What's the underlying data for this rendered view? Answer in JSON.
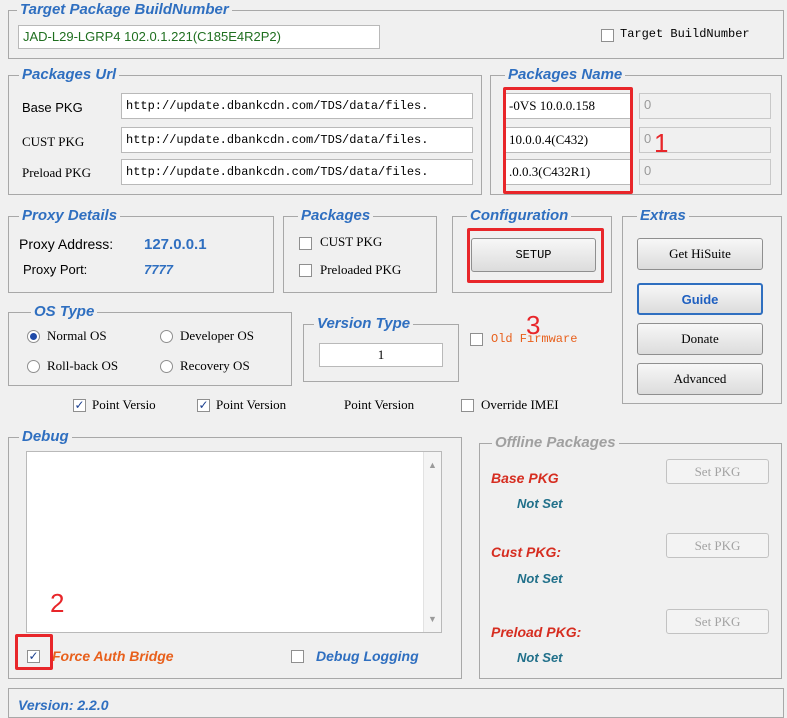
{
  "target_group": {
    "legend": "Target Package BuildNumber",
    "build_number_value": "JAD-L29-LGRP4 102.0.1.221(C185E4R2P2)",
    "checkbox_label": "Target BuildNumber"
  },
  "packages_url": {
    "legend": "Packages Url",
    "rows": [
      {
        "label": "Base PKG",
        "url": "http://update.dbankcdn.com/TDS/data/files."
      },
      {
        "label": "CUST PKG",
        "url": "http://update.dbankcdn.com/TDS/data/files."
      },
      {
        "label": "Preload PKG",
        "url": "http://update.dbankcdn.com/TDS/data/files."
      }
    ]
  },
  "packages_name": {
    "legend": "Packages Name",
    "names": [
      "-0VS 10.0.0.158",
      "10.0.0.4(C432)",
      ".0.0.3(C432R1)"
    ],
    "values": [
      "0",
      "0",
      "0"
    ]
  },
  "proxy": {
    "legend": "Proxy Details",
    "address_label": "Proxy Address:",
    "address_value": "127.0.0.1",
    "port_label": "Proxy Port:",
    "port_value": "7777"
  },
  "packages": {
    "legend": "Packages",
    "cust_pkg": "CUST PKG",
    "preloaded_pkg": "Preloaded PKG"
  },
  "configuration": {
    "legend": "Configuration",
    "setup_button": "SETUP"
  },
  "extras": {
    "legend": "Extras",
    "buttons": [
      "Get HiSuite",
      "Guide",
      "Donate",
      "Advanced"
    ]
  },
  "os_type": {
    "legend": "OS Type",
    "normal": "Normal OS",
    "developer": "Developer OS",
    "rollback": "Roll-back OS",
    "recovery": "Recovery OS"
  },
  "version_type": {
    "legend": "Version Type",
    "value": "1"
  },
  "old_firmware_label": "Old Firmware",
  "point_version_row": {
    "pv1": "Point Versio",
    "pv2": "Point Version",
    "pv3": "Point Version",
    "override_imei": "Override IMEI"
  },
  "debug": {
    "legend": "Debug",
    "force_auth_bridge": "Force Auth Bridge",
    "debug_logging": "Debug Logging"
  },
  "offline_packages": {
    "legend": "Offline Packages",
    "rows": [
      {
        "label": "Base PKG",
        "status": "Not Set",
        "button": "Set PKG"
      },
      {
        "label": "Cust PKG:",
        "status": "Not Set",
        "button": "Set PKG"
      },
      {
        "label": "Preload PKG:",
        "status": "Not Set",
        "button": "Set PKG"
      }
    ]
  },
  "version_footer": "Version: 2.2.0",
  "annotations": [
    "1",
    "2",
    "3"
  ],
  "colors": {
    "accent_blue": "#2f6fc0",
    "annotation_red": "#e8262a",
    "offline_red": "#d62d20",
    "offline_teal": "#21708a"
  }
}
